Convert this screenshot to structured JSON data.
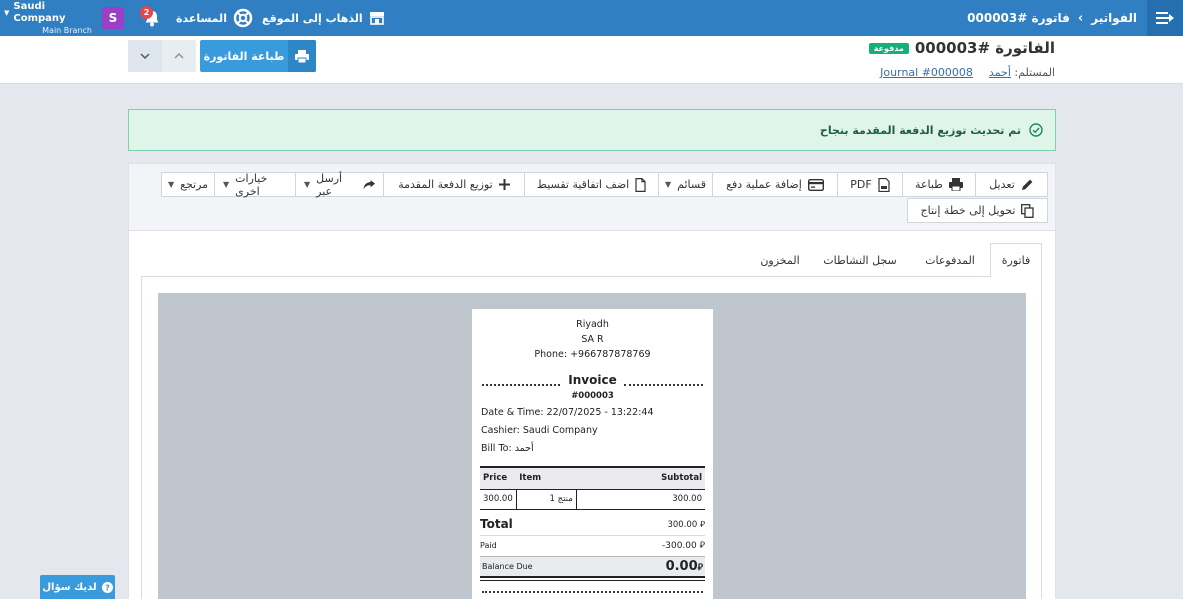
{
  "topbar": {
    "breadcrumb_parent": "الفواتير",
    "breadcrumb_current": "فاتورة #000003",
    "goto_site": "الذهاب إلى الموقع",
    "help": "المساعدة",
    "notif_count": "2",
    "avatar_letter": "S",
    "company_name": "Saudi Company",
    "branch_name": "Main Branch"
  },
  "header": {
    "title": "الفاتورة #000003",
    "status_badge": "مدفوعة",
    "recipient_label": "المستلم:",
    "recipient_name": "أحمد",
    "journal_link": "Journal #000008",
    "print_button": "طباعة الفاتورة"
  },
  "alert": {
    "message": "تم تحديث توزيع الدفعة المقدمة بنجاح"
  },
  "actions": {
    "edit": "تعديل",
    "print": "طباعة",
    "pdf": "PDF",
    "add_payment": "إضافة عملية دفع",
    "lists": "قسائم",
    "add_installment": "اضف اتفاقية تقسيط",
    "distribute_advance": "توزيع الدفعة المقدمة",
    "send_via": "أرسل عبر",
    "more_options": "خيارات اخرى",
    "refund": "مرتجع",
    "convert_production": "تحويل إلى خطة إنتاج"
  },
  "tabs": [
    "فاتورة",
    "المدفوعات",
    "سجل النشاطات",
    "المخزون"
  ],
  "receipt": {
    "city": "Riyadh",
    "country": "SA R",
    "phone": "Phone: +966787878769",
    "heading": "Invoice",
    "number": "#000003",
    "datetime": "Date & Time: 22/07/2025 - 13:22:44",
    "cashier": "Cashier: Saudi Company",
    "bill_to": "Bill To: أحمد",
    "columns": {
      "price": "Price",
      "item": "Item",
      "subtotal": "Subtotal"
    },
    "row": {
      "price": "300.00",
      "item": "منتج 1",
      "subtotal": "300.00"
    },
    "total_label": "Total",
    "total_value": "300.00",
    "paid_label": "Paid",
    "paid_value": "-300.00",
    "balance_label": "Balance Due",
    "balance_value": "0.00",
    "currency_symbol": "⃁"
  },
  "help_widget": {
    "label": "لديك سؤال"
  },
  "colors": {
    "primary": "#2f7fc2",
    "success": "#13b07a",
    "accent_button": "#3a9bdc",
    "avatar": "#9b3fc6"
  }
}
